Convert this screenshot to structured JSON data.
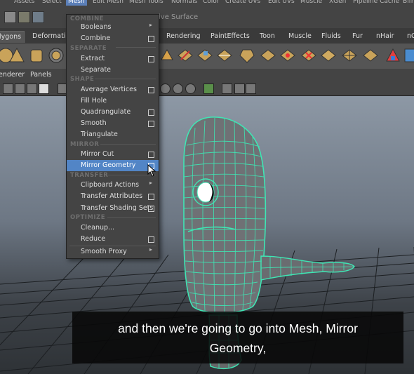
{
  "main_menu": [
    "Assets",
    "Select",
    "Mesh",
    "Edit Mesh",
    "Mesh Tools",
    "Normals",
    "Color",
    "Create UVs",
    "Edit UVs",
    "Muscle",
    "XGen",
    "Pipeline Cache",
    "Bifr"
  ],
  "status_live_text": "ive Surface",
  "shelf_tabs": [
    "lygons",
    "Deformatio",
    "Rendering",
    "PaintEffects",
    "Toon",
    "Muscle",
    "Fluids",
    "Fur",
    "nHair",
    "nC"
  ],
  "panel_menu": [
    "enderer",
    "Panels"
  ],
  "mesh_menu": {
    "items": {
      "booleans": "Booleans",
      "combine": "Combine",
      "extract": "Extract",
      "separate": "Separate",
      "average_vertices": "Average Vertices",
      "fill_hole": "Fill Hole",
      "quadrangulate": "Quadrangulate",
      "smooth": "Smooth",
      "triangulate": "Triangulate",
      "mirror_cut": "Mirror Cut",
      "mirror_geometry": "Mirror Geometry",
      "clipboard_actions": "Clipboard Actions",
      "transfer_attributes": "Transfer Attributes",
      "transfer_shading_sets": "Transfer Shading Sets",
      "cleanup": "Cleanup...",
      "reduce": "Reduce",
      "smooth_proxy": "Smooth Proxy"
    },
    "sections": {
      "combine": "COMBINE",
      "separate": "SEPARATE",
      "shape": "SHAPE",
      "mirror": "MIRROR",
      "transfer": "TRANSFER",
      "optimize": "OPTIMIZE"
    },
    "highlighted": "Mirror Geometry"
  },
  "subtitle": {
    "line1": "and then we're going to go into Mesh, Mirror",
    "line2": "Geometry,"
  },
  "colors": {
    "highlight": "#5285c6",
    "wireframe": "#3fe6b4",
    "menu_bg": "#444444"
  }
}
